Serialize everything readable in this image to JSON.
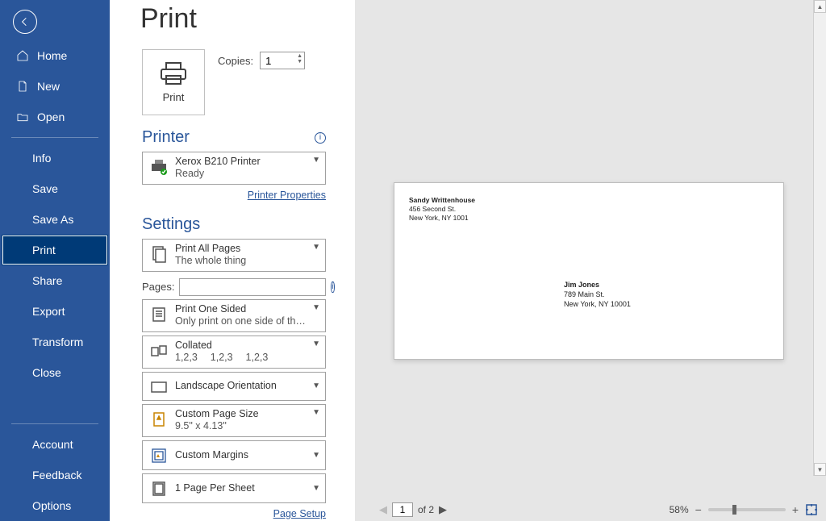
{
  "title": "Print",
  "sidebar": {
    "top": [
      {
        "label": "Home",
        "icon": "home-icon"
      },
      {
        "label": "New",
        "icon": "new-doc-icon"
      },
      {
        "label": "Open",
        "icon": "open-folder-icon"
      }
    ],
    "mid": [
      {
        "label": "Info"
      },
      {
        "label": "Save"
      },
      {
        "label": "Save As"
      },
      {
        "label": "Print",
        "selected": true
      },
      {
        "label": "Share"
      },
      {
        "label": "Export"
      },
      {
        "label": "Transform"
      },
      {
        "label": "Close"
      }
    ],
    "bottom": [
      {
        "label": "Account"
      },
      {
        "label": "Feedback"
      },
      {
        "label": "Options"
      }
    ]
  },
  "print": {
    "button_label": "Print",
    "copies_label": "Copies:",
    "copies_value": "1"
  },
  "printer": {
    "heading": "Printer",
    "name": "Xerox B210 Printer",
    "status": "Ready",
    "properties_link": "Printer Properties"
  },
  "settings": {
    "heading": "Settings",
    "pages_label": "Pages:",
    "pages_value": "",
    "items": [
      {
        "id": "scope",
        "line1": "Print All Pages",
        "line2": "The whole thing"
      },
      {
        "id": "sides",
        "line1": "Print One Sided",
        "line2": "Only print on one side of the..."
      },
      {
        "id": "collate",
        "line1": "Collated",
        "line2": "1,2,3  1,2,3  1,2,3"
      },
      {
        "id": "orient",
        "line1": "Landscape Orientation",
        "line2": ""
      },
      {
        "id": "pagesize",
        "line1": "Custom Page Size",
        "line2": "9.5\" x 4.13\""
      },
      {
        "id": "margins",
        "line1": "Custom Margins",
        "line2": ""
      },
      {
        "id": "persheet",
        "line1": "1 Page Per Sheet",
        "line2": ""
      }
    ],
    "page_setup_link": "Page Setup"
  },
  "preview": {
    "from_name": "Sandy Writtenhouse",
    "from_street": "456 Second St.",
    "from_city": "New York, NY 1001",
    "to_name": "Jim Jones",
    "to_street": "789 Main St.",
    "to_city": "New York, NY 10001",
    "page_current": "1",
    "page_of_label": "of 2",
    "zoom_label": "58%"
  }
}
